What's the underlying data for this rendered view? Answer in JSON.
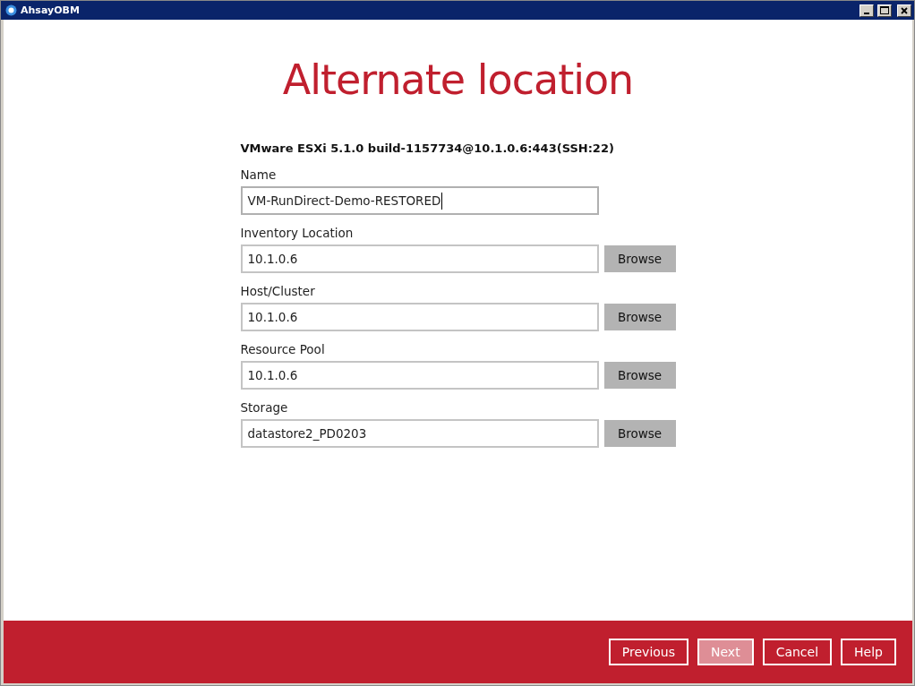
{
  "window": {
    "title": "AhsayOBM"
  },
  "heading": "Alternate location",
  "host": "VMware ESXi 5.1.0 build-1157734@10.1.0.6:443(SSH:22)",
  "fields": [
    {
      "label": "Name",
      "value": "VM-RunDirect-Demo-RESTORED",
      "focused": true
    },
    {
      "label": "Inventory Location",
      "value": "10.1.0.6",
      "focused": false,
      "button": "Browse"
    },
    {
      "label": "Host/Cluster",
      "value": "10.1.0.6",
      "focused": false,
      "button": "Browse"
    },
    {
      "label": "Resource Pool",
      "value": "10.1.0.6",
      "focused": false,
      "button": "Browse"
    },
    {
      "label": "Storage",
      "value": "datastore2_PD0203",
      "focused": false,
      "button": "Browse"
    }
  ],
  "footer_buttons": [
    {
      "label": "Previous",
      "disabled": false
    },
    {
      "label": "Next",
      "disabled": true
    },
    {
      "label": "Cancel",
      "disabled": false
    },
    {
      "label": "Help",
      "disabled": false
    }
  ]
}
